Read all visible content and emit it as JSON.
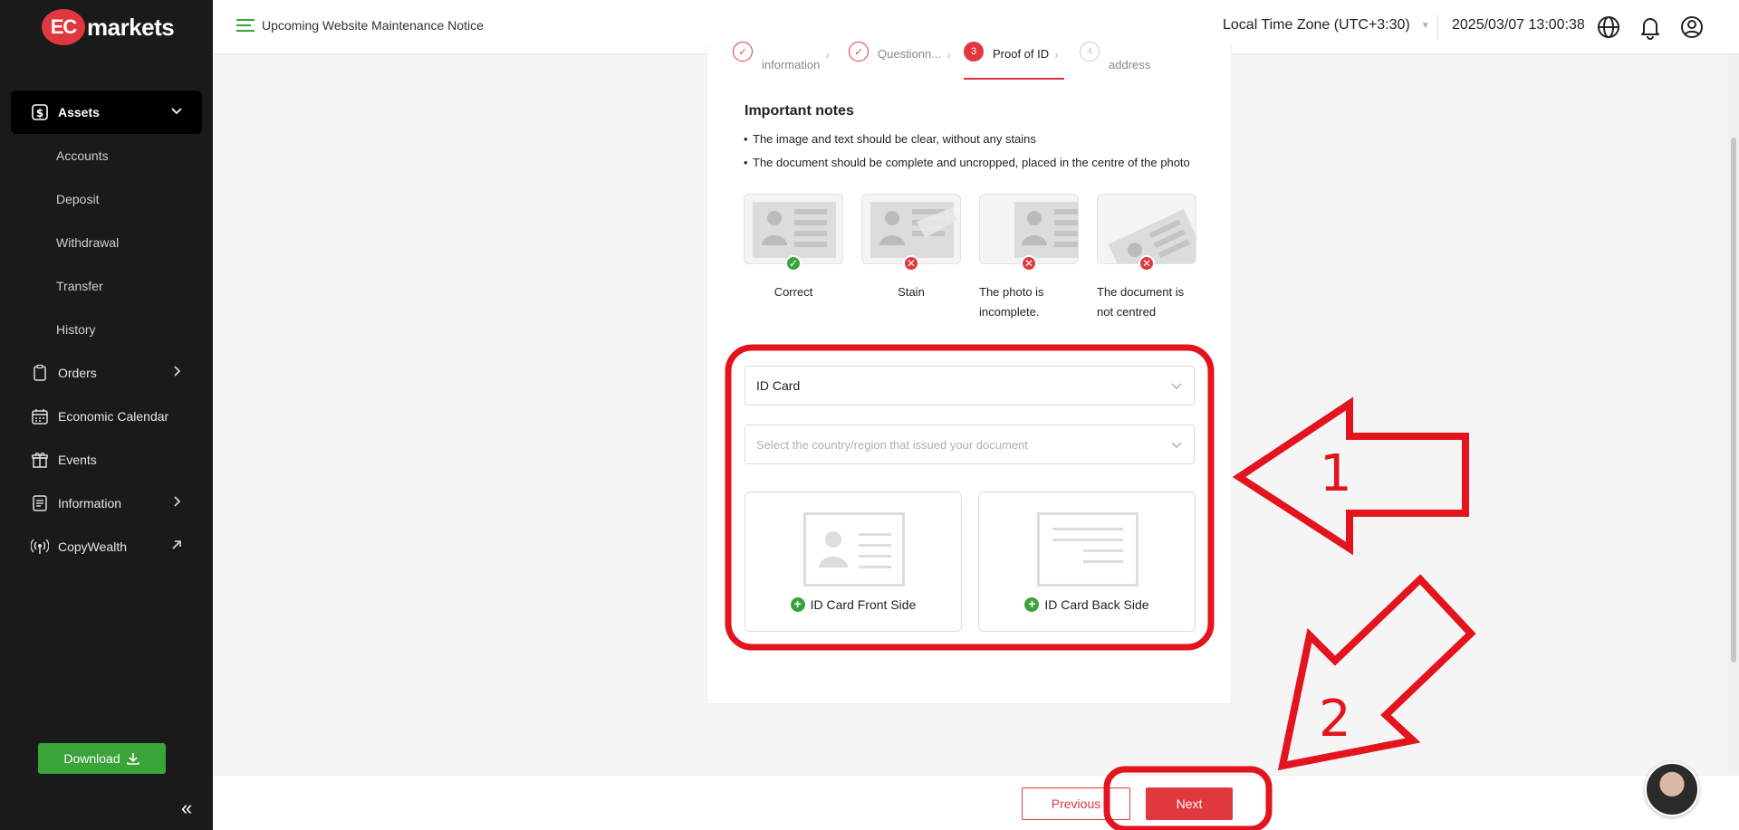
{
  "sidebar": {
    "logo_mark": "EC",
    "logo_text": "markets",
    "items": [
      {
        "label": "Assets"
      },
      {
        "label": "Accounts"
      },
      {
        "label": "Deposit"
      },
      {
        "label": "Withdrawal"
      },
      {
        "label": "Transfer"
      },
      {
        "label": "History"
      },
      {
        "label": "Orders"
      },
      {
        "label": "Economic Calendar"
      },
      {
        "label": "Events"
      },
      {
        "label": "Information"
      },
      {
        "label": "CopyWealth"
      }
    ],
    "download_label": "Download",
    "collapse_glyph": "«"
  },
  "header": {
    "notice": "Upcoming Website Maintenance Notice",
    "timezone": "Local Time Zone (UTC+3:30)",
    "datetime": "2025/03/07 13:00:38"
  },
  "steps": [
    {
      "label": "information"
    },
    {
      "label": "Questionn..."
    },
    {
      "label": "Proof of ID",
      "number": "3"
    },
    {
      "label": "address",
      "number": "4"
    }
  ],
  "notes": {
    "title": "Important notes",
    "items": [
      "The image and text should be clear, without any stains",
      "The document should be complete and uncropped, placed in the centre of the photo"
    ]
  },
  "examples": [
    {
      "label": "Correct",
      "status": "ok"
    },
    {
      "label": "Stain",
      "status": "bad"
    },
    {
      "label": "The photo is incomplete.",
      "status": "bad"
    },
    {
      "label": "The document is not centred",
      "status": "bad"
    }
  ],
  "form": {
    "document_type": "ID Card",
    "country_placeholder": "Select the country/region that issued your document",
    "front_label": "ID Card Front Side",
    "back_label": "ID Card Back Side"
  },
  "footer": {
    "previous_label": "Previous",
    "next_label": "Next"
  },
  "annotations": {
    "arrow1_label": "1",
    "arrow2_label": "2"
  },
  "colors": {
    "accent": "#e0383e",
    "success": "#3aa33a",
    "annotation": "#e3141e"
  }
}
